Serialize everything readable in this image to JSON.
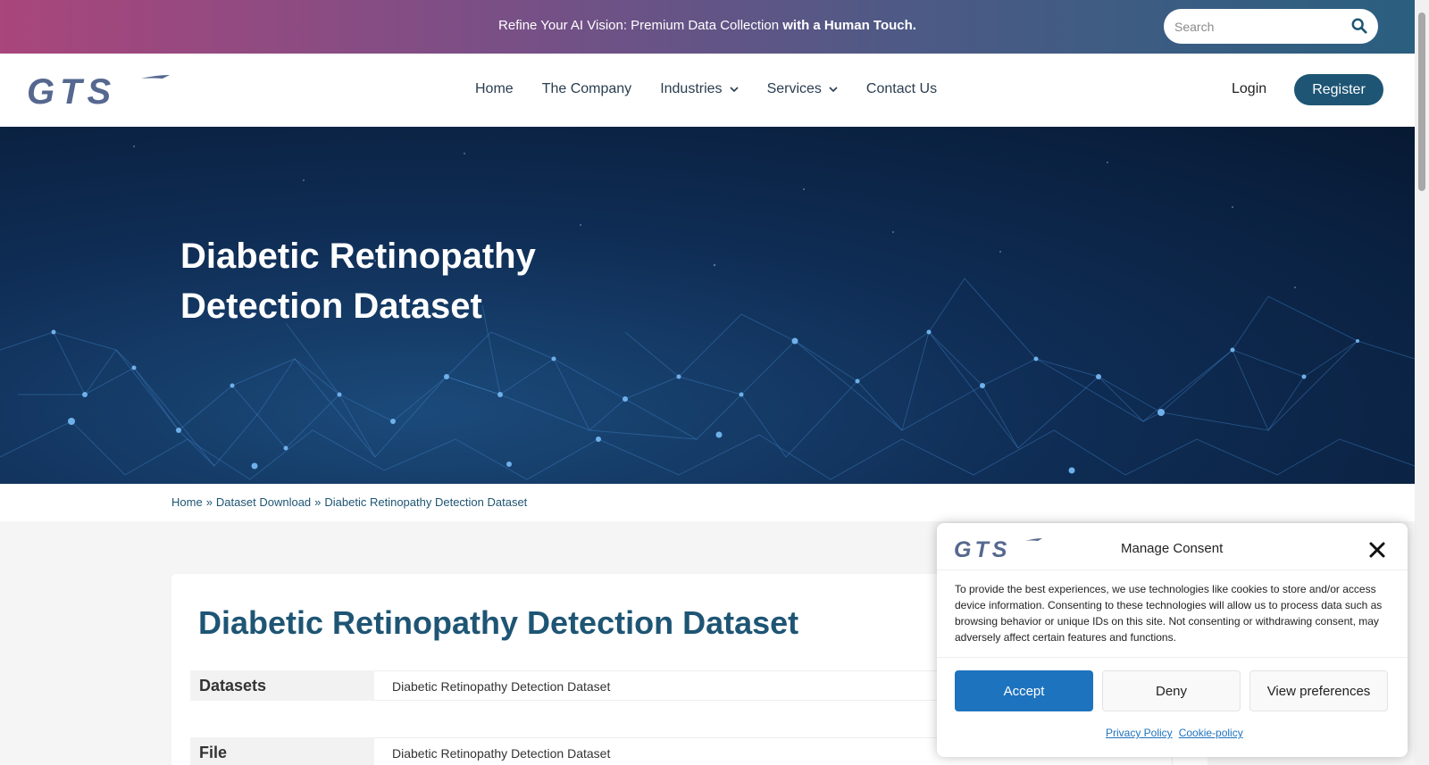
{
  "topbar": {
    "text_regular": "Refine Your AI Vision: Premium Data Collection ",
    "text_bold": "with a Human Touch.",
    "search_placeholder": "Search"
  },
  "nav": {
    "logo_text": "GTS",
    "items": [
      {
        "label": "Home",
        "has_dropdown": false
      },
      {
        "label": "The Company",
        "has_dropdown": false
      },
      {
        "label": "Industries",
        "has_dropdown": true
      },
      {
        "label": "Services",
        "has_dropdown": true
      },
      {
        "label": "Contact Us",
        "has_dropdown": false
      }
    ],
    "login": "Login",
    "register": "Register"
  },
  "hero": {
    "title": "Diabetic Retinopathy Detection Dataset"
  },
  "breadcrumb": {
    "items": [
      "Home",
      "Dataset Download",
      "Diabetic Retinopathy Detection Dataset"
    ],
    "separator": "»"
  },
  "content": {
    "title": "Diabetic Retinopathy Detection Dataset",
    "rows": [
      {
        "key": "Datasets",
        "value": "Diabetic Retinopathy Detection Dataset"
      },
      {
        "key": "File",
        "value": "Diabetic Retinopathy Detection Dataset"
      }
    ]
  },
  "consent": {
    "title": "Manage Consent",
    "text": "To provide the best experiences, we use technologies like cookies to store and/or access device information. Consenting to these technologies will allow us to process data such as browsing behavior or unique IDs on this site. Not consenting or withdrawing consent, may adversely affect certain features and functions.",
    "accept": "Accept",
    "deny": "Deny",
    "preferences": "View preferences",
    "privacy_link": "Privacy Policy",
    "cookie_link": "Cookie-policy"
  },
  "colors": {
    "brand": "#1e5574",
    "accept": "#1e73be",
    "logo": "#56688f"
  }
}
